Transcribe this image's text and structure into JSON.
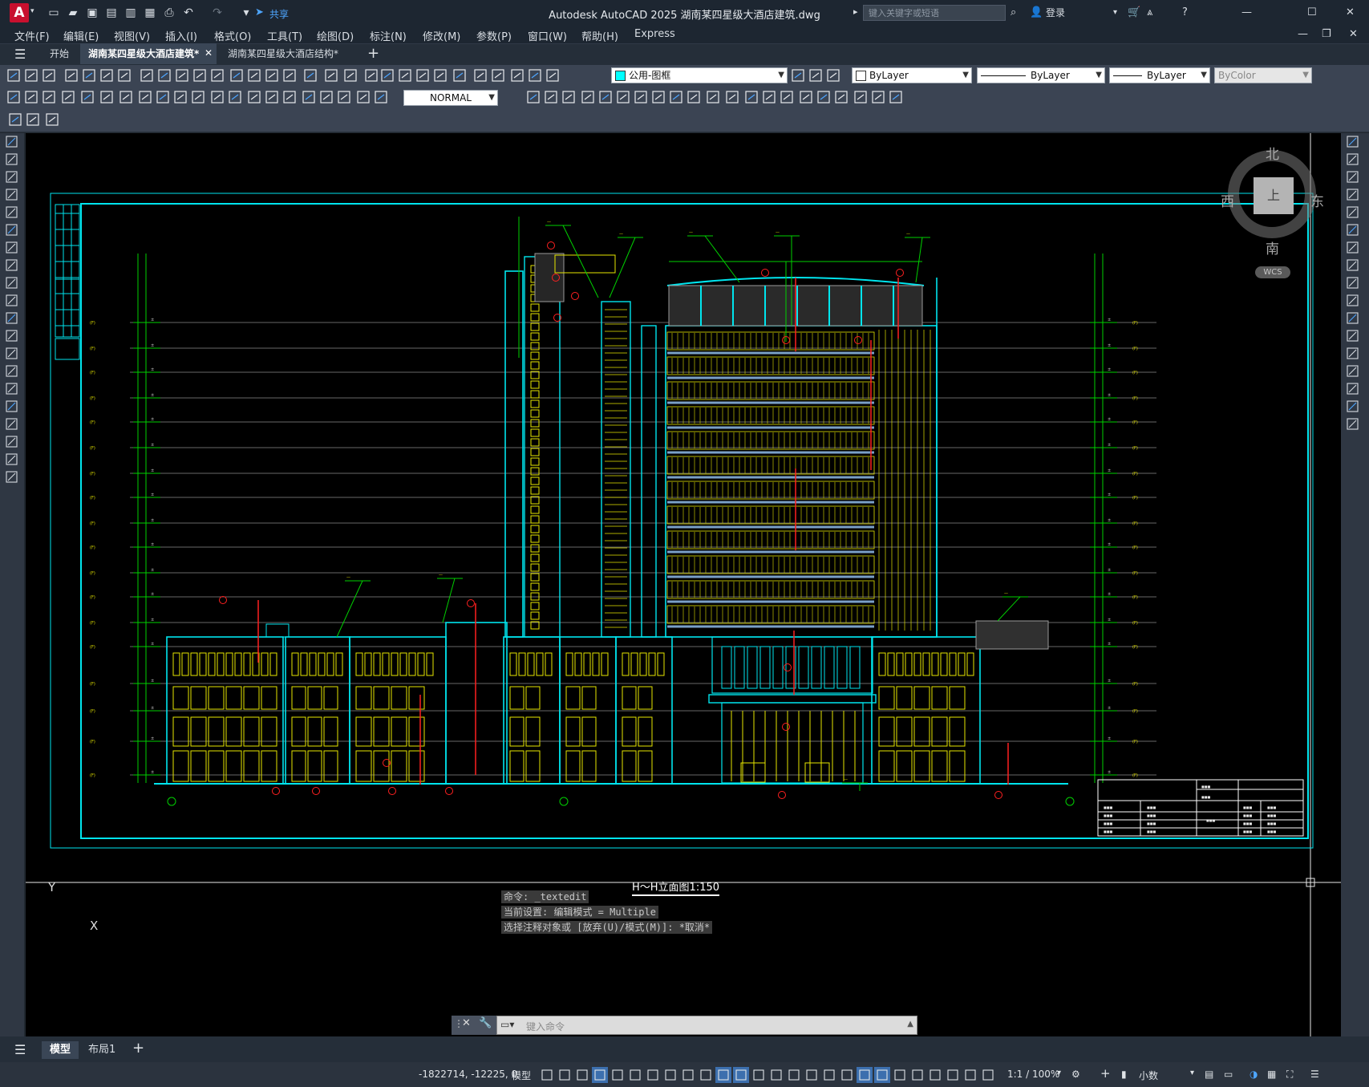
{
  "app": {
    "title": "Autodesk AutoCAD 2025    湖南某四星级大酒店建筑.dwg",
    "logo_letter": "A",
    "share_label": "共享",
    "search_placeholder": "键入关键字或短语",
    "login_label": "登录"
  },
  "menu": [
    "文件(F)",
    "编辑(E)",
    "视图(V)",
    "插入(I)",
    "格式(O)",
    "工具(T)",
    "绘图(D)",
    "标注(N)",
    "修改(M)",
    "参数(P)",
    "窗口(W)",
    "帮助(H)",
    "Express"
  ],
  "doc_tabs": [
    {
      "label": "开始",
      "active": false
    },
    {
      "label": "湖南某四星级大酒店建筑*",
      "active": true
    },
    {
      "label": "湖南某四星级大酒店结构*",
      "active": false
    }
  ],
  "toolbar": {
    "layer_name": "公用-图框",
    "color": "ByLayer",
    "linetype": "ByLayer",
    "lineweight": "ByLayer",
    "plotstyle": "ByColor",
    "dimstyle": "NORMAL"
  },
  "viewcube": {
    "north": "北",
    "south": "南",
    "east": "东",
    "west": "西",
    "face": "上",
    "wcs": "WCS"
  },
  "drawing": {
    "caption": "H～H立面图1:150",
    "ucs_x": "X",
    "ucs_y": "Y"
  },
  "command": {
    "history": [
      "命令: _textedit",
      "当前设置: 编辑模式 = Multiple",
      "选择注释对象或 [放弃(U)/模式(M)]: *取消*"
    ],
    "prompt_placeholder": "键入命令"
  },
  "layout_tabs": [
    {
      "label": "模型",
      "active": true
    },
    {
      "label": "布局1",
      "active": false
    }
  ],
  "status": {
    "coords": "-1822714, -12225, 0",
    "space": "模型",
    "scale": "1:1 / 100%",
    "units": "小数"
  },
  "colors": {
    "cyan": "#00e5ee",
    "yellow": "#e6e600",
    "green": "#00d000",
    "red": "#ff2020",
    "grey": "#8a8a8a",
    "canvas_bg": "#000000"
  }
}
